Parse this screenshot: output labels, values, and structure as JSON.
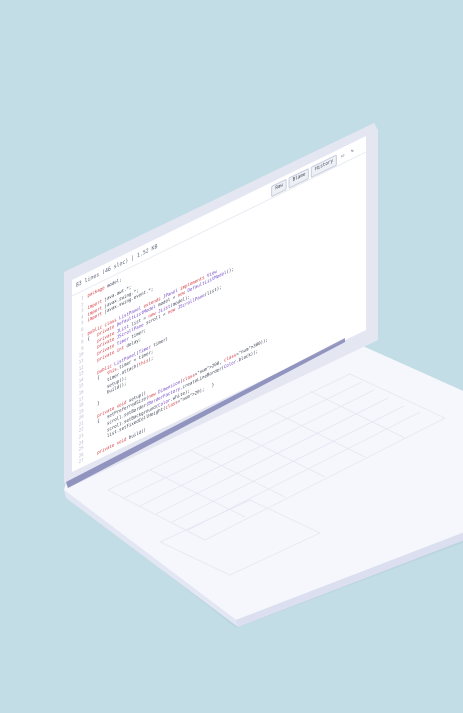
{
  "file_info": {
    "lines": "83 lines (46 sloc)",
    "size": "1.52 KB"
  },
  "toolbar": {
    "raw_label": "Raw",
    "blame_label": "Blame",
    "history_label": "History"
  },
  "icons": {
    "desktop": "desktop-icon",
    "edit": "pencil-icon"
  },
  "colors": {
    "background": "#c2dde6",
    "laptop_body": "#f4f5fb",
    "keyword": "#d3343b",
    "type": "#6f42c1",
    "number": "#1f6feb"
  },
  "code_lines": [
    "package model;",
    "",
    "import java.awt.*;",
    "import javax.swing.*;",
    "import javax.swing.event.*;",
    "",
    "public class ListPanel extends JPanel implements View",
    "{   private DefaultListModel model = new DefaultListModel();",
    "    private JList list = new JList(model);",
    "    private JScrollPane scroll = new JScrollPane(list);",
    "    private Timer timer;",
    "    private int delay;",
    "",
    "    public ListPanel(Timer timer)",
    "    {   this.timer = timer;",
    "        timer.attach(this);",
    "        setup();",
    "        build();",
    "    }",
    "",
    "    private void setup()",
    "    {   setPreferredSize(new Dimension(200, 300));",
    "        scroll.setBorder(BorderFactory.createLineBorder(Color.black));",
    "        scroll.setBackground(Color.white);",
    "        list.setFixedCellHeight(20);   }",
    "",
    "    private void build()"
  ]
}
